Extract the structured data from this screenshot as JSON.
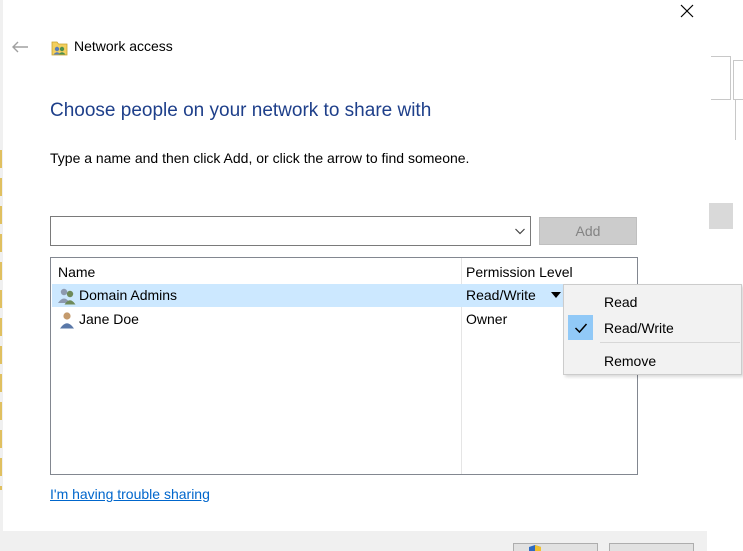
{
  "window": {
    "title": "Network access",
    "close_glyph": "✕"
  },
  "main": {
    "heading": "Choose people on your network to share with",
    "instructions": "Type a name and then click Add, or click the arrow to find someone.",
    "name_input_value": "",
    "add_label": "Add"
  },
  "list": {
    "columns": {
      "name": "Name",
      "permission": "Permission Level"
    },
    "rows": [
      {
        "name": "Domain Admins",
        "permission": "Read/Write",
        "icon": "group-icon",
        "selected": true
      },
      {
        "name": "Jane Doe",
        "permission": "Owner",
        "icon": "user-icon",
        "selected": false
      }
    ]
  },
  "context_menu": {
    "items": [
      {
        "label": "Read",
        "checked": false
      },
      {
        "label": "Read/Write",
        "checked": true
      },
      {
        "label": "Remove",
        "checked": false
      }
    ]
  },
  "links": {
    "trouble": "I'm having trouble sharing"
  },
  "colors": {
    "heading": "#1e3f8a",
    "selection": "#cce8ff",
    "menu_check": "#91c9f7",
    "link": "#0066cc"
  }
}
